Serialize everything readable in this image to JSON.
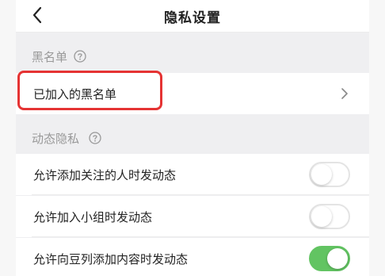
{
  "header": {
    "title": "隐私设置",
    "back_icon": "chevron-left-icon"
  },
  "blacklist_section": {
    "label": "黑名单",
    "help_icon": "question-circle-icon",
    "item": {
      "label": "已加入的黑名单",
      "arrow_icon": "chevron-right-icon"
    }
  },
  "activity_section": {
    "label": "动态隐私",
    "help_icon": "question-circle-icon",
    "items": [
      {
        "label": "允许添加关注的人时发动态",
        "enabled": false
      },
      {
        "label": "允许加入小组时发动态",
        "enabled": false
      },
      {
        "label": "允许向豆列添加内容时发动态",
        "enabled": true
      }
    ]
  },
  "colors": {
    "toggle_on": "#62c462",
    "highlight": "#e53333"
  }
}
